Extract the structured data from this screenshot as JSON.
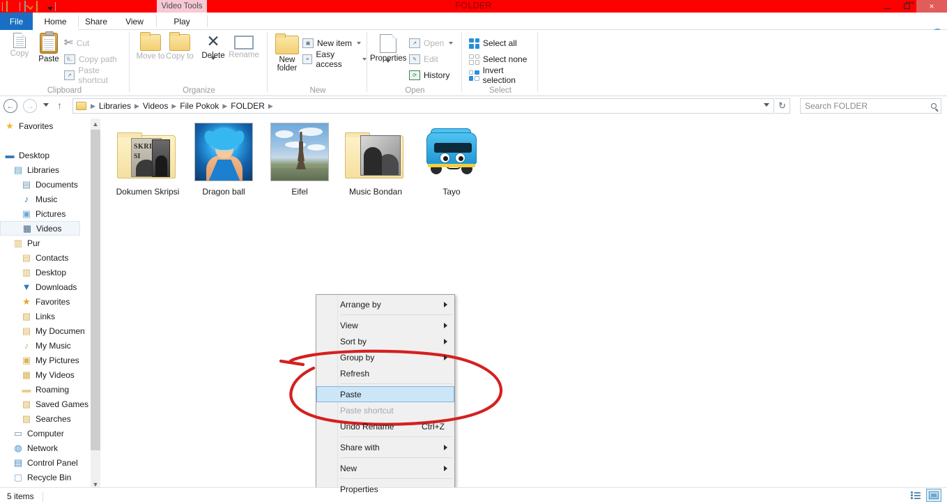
{
  "window": {
    "title": "FOLDER",
    "contextual_tab_group": "Video Tools",
    "quick_access": [
      "folder-icon",
      "properties-icon",
      "new-folder-icon",
      "customize-caret"
    ],
    "controls": {
      "minimize": "minimize-icon",
      "maximize": "maximize-icon",
      "close": "×"
    }
  },
  "tabs": [
    {
      "label": "File",
      "id": "file"
    },
    {
      "label": "Home",
      "id": "home"
    },
    {
      "label": "Share",
      "id": "share"
    },
    {
      "label": "View",
      "id": "view"
    },
    {
      "label": "Play",
      "id": "play"
    }
  ],
  "ribbon": {
    "collapse_icon": "chevron-up-icon",
    "help_icon": "?",
    "groups": [
      {
        "label": "Clipboard",
        "big_buttons": [
          {
            "label": "Copy",
            "enabled": false
          },
          {
            "label": "Paste",
            "enabled": true
          }
        ],
        "small_buttons": [
          {
            "label": "Cut",
            "enabled": false
          },
          {
            "label": "Copy path",
            "enabled": false
          },
          {
            "label": "Paste shortcut",
            "enabled": false
          }
        ]
      },
      {
        "label": "Organize",
        "big_buttons": [
          {
            "label": "Move to",
            "enabled": false,
            "has_caret": true
          },
          {
            "label": "Copy to",
            "enabled": false,
            "has_caret": true
          },
          {
            "label": "Delete",
            "enabled": true,
            "has_caret": true
          },
          {
            "label": "Rename",
            "enabled": false
          }
        ]
      },
      {
        "label": "New",
        "big_buttons": [
          {
            "label": "New folder",
            "enabled": true
          }
        ],
        "small_buttons": [
          {
            "label": "New item",
            "enabled": true,
            "has_caret": true
          },
          {
            "label": "Easy access",
            "enabled": true,
            "has_caret": true
          }
        ]
      },
      {
        "label": "Open",
        "big_buttons": [
          {
            "label": "Properties",
            "enabled": true,
            "has_caret": true
          }
        ],
        "small_buttons": [
          {
            "label": "Open",
            "enabled": false,
            "has_caret": true
          },
          {
            "label": "Edit",
            "enabled": false
          },
          {
            "label": "History",
            "enabled": true
          }
        ]
      },
      {
        "label": "Select",
        "small_buttons": [
          {
            "label": "Select all",
            "enabled": true
          },
          {
            "label": "Select none",
            "enabled": true
          },
          {
            "label": "Invert selection",
            "enabled": true
          }
        ]
      }
    ]
  },
  "addressbar": {
    "back": "◄",
    "forward": "►",
    "recent_caret": "▾",
    "up": "↑",
    "breadcrumb": [
      "Libraries",
      "Videos",
      "File Pokok",
      "FOLDER"
    ],
    "refresh_icon": "↻",
    "dropdown_caret": "▾"
  },
  "search": {
    "placeholder": "Search FOLDER",
    "icon": "search-icon"
  },
  "sidebar": {
    "items": [
      {
        "label": "Favorites",
        "icon": "star-icon",
        "indent": 0,
        "selected": false
      },
      {
        "label": "",
        "icon": "spacer",
        "indent": 0,
        "selected": false
      },
      {
        "label": "Desktop",
        "icon": "monitor-icon",
        "indent": 0,
        "selected": false
      },
      {
        "label": "Libraries",
        "icon": "library-icon",
        "indent": 1,
        "selected": false
      },
      {
        "label": "Documents",
        "icon": "document-icon",
        "indent": 2,
        "selected": false
      },
      {
        "label": "Music",
        "icon": "music-note-icon",
        "indent": 2,
        "selected": false
      },
      {
        "label": "Pictures",
        "icon": "picture-icon",
        "indent": 2,
        "selected": false
      },
      {
        "label": "Videos",
        "icon": "video-icon",
        "indent": 2,
        "selected": true
      },
      {
        "label": "Pur",
        "icon": "user-folder-icon",
        "indent": 1,
        "selected": false
      },
      {
        "label": "Contacts",
        "icon": "contacts-icon",
        "indent": 2,
        "selected": false
      },
      {
        "label": "Desktop",
        "icon": "desktop-folder-icon",
        "indent": 2,
        "selected": false
      },
      {
        "label": "Downloads",
        "icon": "downloads-icon",
        "indent": 2,
        "selected": false
      },
      {
        "label": "Favorites",
        "icon": "favorites-folder-icon",
        "indent": 2,
        "selected": false
      },
      {
        "label": "Links",
        "icon": "links-icon",
        "indent": 2,
        "selected": false
      },
      {
        "label": "My Documen",
        "icon": "my-documents-icon",
        "indent": 2,
        "selected": false
      },
      {
        "label": "My Music",
        "icon": "my-music-icon",
        "indent": 2,
        "selected": false
      },
      {
        "label": "My Pictures",
        "icon": "my-pictures-icon",
        "indent": 2,
        "selected": false
      },
      {
        "label": "My Videos",
        "icon": "my-videos-icon",
        "indent": 2,
        "selected": false
      },
      {
        "label": "Roaming",
        "icon": "roaming-icon",
        "indent": 2,
        "selected": false
      },
      {
        "label": "Saved Games",
        "icon": "saved-games-icon",
        "indent": 2,
        "selected": false
      },
      {
        "label": "Searches",
        "icon": "searches-icon",
        "indent": 2,
        "selected": false
      },
      {
        "label": "Computer",
        "icon": "computer-icon",
        "indent": 1,
        "selected": false
      },
      {
        "label": "Network",
        "icon": "network-icon",
        "indent": 1,
        "selected": false
      },
      {
        "label": "Control Panel",
        "icon": "control-panel-icon",
        "indent": 1,
        "selected": false
      },
      {
        "label": "Recycle Bin",
        "icon": "recycle-bin-icon",
        "indent": 1,
        "selected": false
      }
    ]
  },
  "files": [
    {
      "name": "Dokumen Skripsi",
      "type": "folder",
      "thumb": "folder-documents"
    },
    {
      "name": "Dragon ball",
      "type": "image",
      "thumb": "dragonball"
    },
    {
      "name": "Eifel",
      "type": "image",
      "thumb": "eiffel"
    },
    {
      "name": "Music Bondan",
      "type": "folder",
      "thumb": "folder-music"
    },
    {
      "name": "Tayo",
      "type": "image",
      "thumb": "tayo-bus"
    }
  ],
  "context_menu": {
    "items": [
      {
        "label": "Arrange by",
        "submenu": true,
        "enabled": true,
        "selected": false,
        "accel": ""
      },
      {
        "separator": true
      },
      {
        "label": "View",
        "submenu": true,
        "enabled": true,
        "selected": false,
        "accel": ""
      },
      {
        "label": "Sort by",
        "submenu": true,
        "enabled": true,
        "selected": false,
        "accel": ""
      },
      {
        "label": "Group by",
        "submenu": true,
        "enabled": true,
        "selected": false,
        "accel": ""
      },
      {
        "label": "Refresh",
        "submenu": false,
        "enabled": true,
        "selected": false,
        "accel": ""
      },
      {
        "separator": true
      },
      {
        "label": "Paste",
        "submenu": false,
        "enabled": true,
        "selected": true,
        "accel": ""
      },
      {
        "label": "Paste shortcut",
        "submenu": false,
        "enabled": false,
        "selected": false,
        "accel": ""
      },
      {
        "label": "Undo Rename",
        "submenu": false,
        "enabled": true,
        "selected": false,
        "accel": "Ctrl+Z"
      },
      {
        "separator": true
      },
      {
        "label": "Share with",
        "submenu": true,
        "enabled": true,
        "selected": false,
        "accel": ""
      },
      {
        "separator": true
      },
      {
        "label": "New",
        "submenu": true,
        "enabled": true,
        "selected": false,
        "accel": ""
      },
      {
        "separator": true
      },
      {
        "label": "Properties",
        "submenu": false,
        "enabled": true,
        "selected": false,
        "accel": ""
      }
    ]
  },
  "annotation": {
    "shape": "hand-drawn-ellipse",
    "color": "#d42020",
    "targets": "Paste / Paste shortcut / Undo Rename"
  },
  "statusbar": {
    "item_count": "5 items"
  },
  "view_buttons": [
    {
      "name": "details-view",
      "active": false
    },
    {
      "name": "large-icons-view",
      "active": true
    }
  ],
  "colors": {
    "titlebar": "#ff0000",
    "title_text": "#8b0000",
    "contextual_tab": "#f7c9d4",
    "file_tab": "#1a6fc4",
    "selection": "#cde6f7",
    "annotation": "#d42020"
  }
}
